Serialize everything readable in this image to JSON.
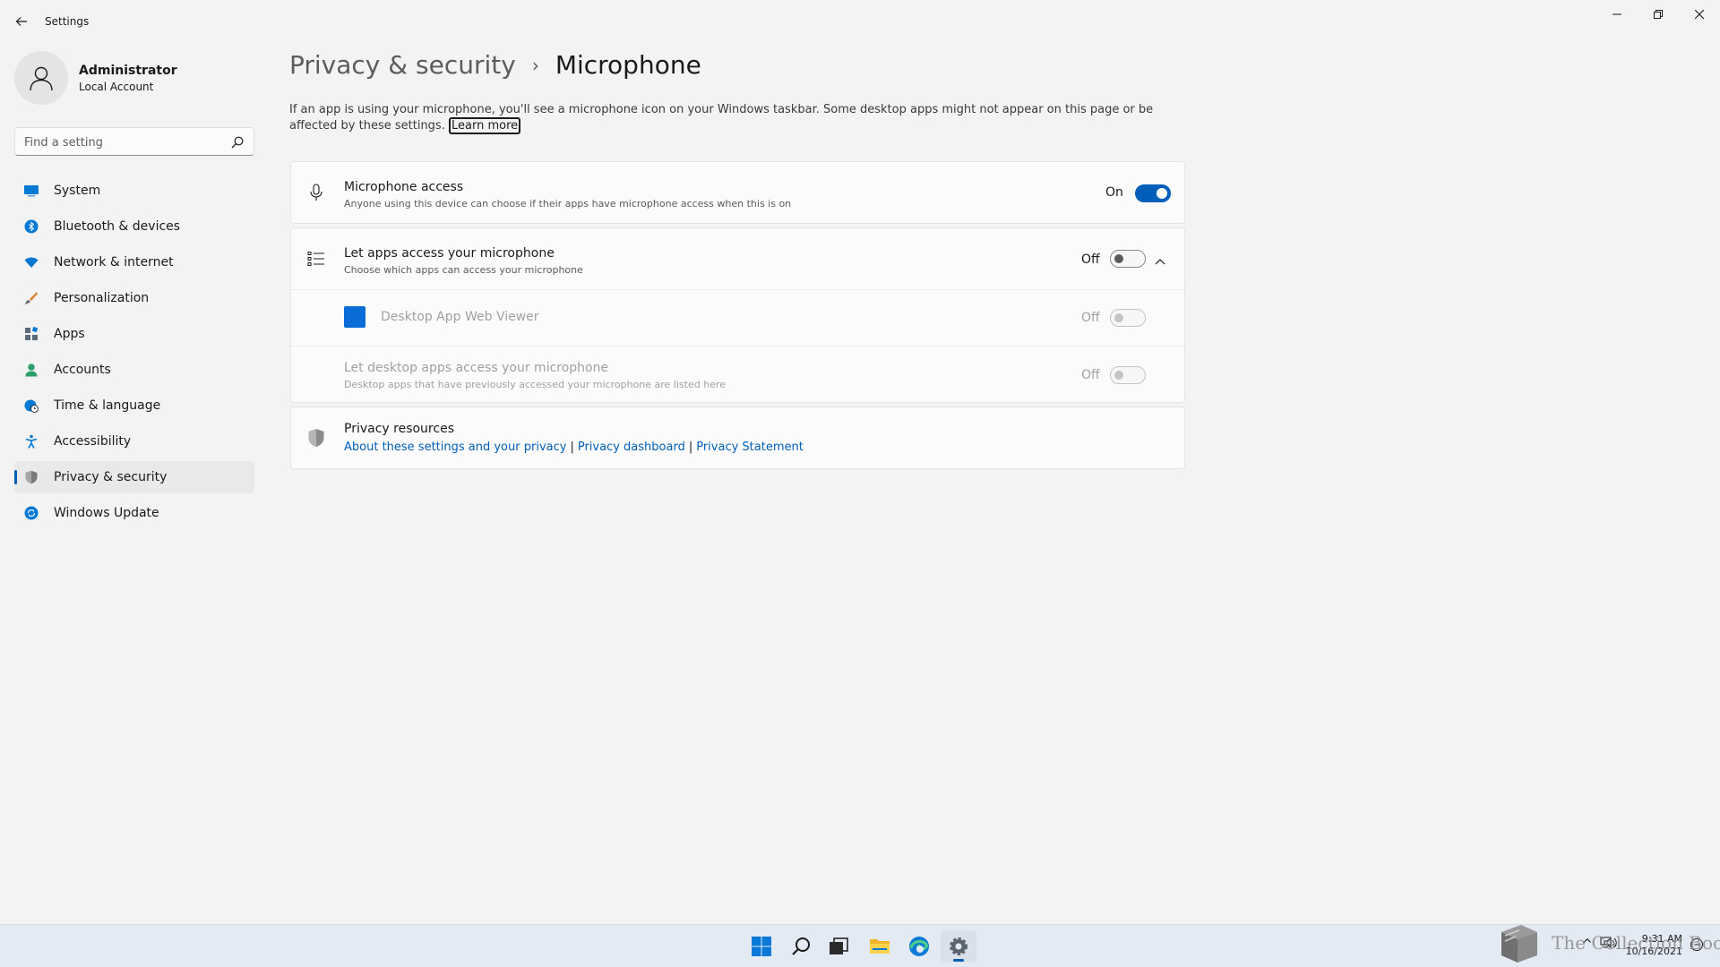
{
  "window": {
    "title": "Settings",
    "controls": {
      "minimize": "minimize",
      "maximize": "restore",
      "close": "close"
    }
  },
  "profile": {
    "name": "Administrator",
    "account_type": "Local Account"
  },
  "search": {
    "placeholder": "Find a setting"
  },
  "sidebar": {
    "items": [
      {
        "label": "System",
        "icon": "system-icon",
        "color": "#0078d4"
      },
      {
        "label": "Bluetooth & devices",
        "icon": "bluetooth-icon",
        "color": "#0078d4"
      },
      {
        "label": "Network & internet",
        "icon": "wifi-icon",
        "color": "#0078d4"
      },
      {
        "label": "Personalization",
        "icon": "brush-icon",
        "color": "#d9822b"
      },
      {
        "label": "Apps",
        "icon": "apps-icon",
        "color": "#5a6a7a"
      },
      {
        "label": "Accounts",
        "icon": "person-icon",
        "color": "#2e9e6b"
      },
      {
        "label": "Time & language",
        "icon": "globe-clock-icon",
        "color": "#0078d4"
      },
      {
        "label": "Accessibility",
        "icon": "accessibility-icon",
        "color": "#0078d4"
      },
      {
        "label": "Privacy & security",
        "icon": "shield-icon",
        "color": "#6b6b6b",
        "selected": true
      },
      {
        "label": "Windows Update",
        "icon": "update-icon",
        "color": "#0078d4"
      }
    ]
  },
  "main": {
    "breadcrumb": {
      "parent": "Privacy & security",
      "current": "Microphone"
    },
    "description": "If an app is using your microphone, you'll see a microphone icon on your Windows taskbar. Some desktop apps might not appear on this page or be affected by these settings.",
    "learn_more": "Learn more",
    "microphone_access": {
      "title": "Microphone access",
      "subtitle": "Anyone using this device can choose if their apps have microphone access when this is on",
      "state": "On"
    },
    "let_apps": {
      "title": "Let apps access your microphone",
      "subtitle": "Choose which apps can access your microphone",
      "state": "Off"
    },
    "desktop_app_web_viewer": {
      "title": "Desktop App Web Viewer",
      "state": "Off"
    },
    "let_desktop_apps": {
      "title": "Let desktop apps access your microphone",
      "subtitle": "Desktop apps that have previously accessed your microphone are listed here",
      "state": "Off"
    },
    "privacy_resources": {
      "title": "Privacy resources",
      "links": [
        "About these settings and your privacy",
        "Privacy dashboard",
        "Privacy Statement"
      ],
      "separator": "|"
    }
  },
  "taskbar": {
    "icons": [
      "windows-start-icon",
      "search-icon",
      "task-view-icon",
      "file-explorer-icon",
      "edge-icon",
      "settings-icon"
    ],
    "clock": {
      "time": "9:31 AM",
      "date": "10/16/2021"
    },
    "tray": {
      "chevron": "^"
    }
  },
  "watermark": {
    "text": "The Collection Book"
  },
  "colors": {
    "accent": "#005fb8",
    "background": "#f3f3f3",
    "card": "#fbfbfb"
  }
}
